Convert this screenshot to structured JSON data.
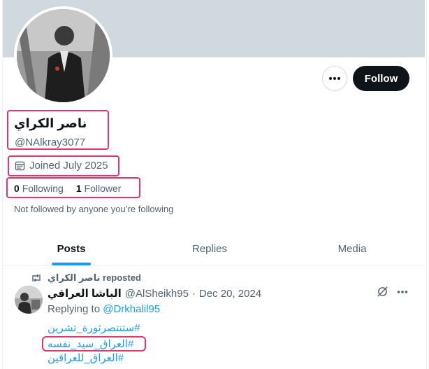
{
  "profile": {
    "display_name": "ناصر الكراي",
    "handle": "@NAlkray3077",
    "joined": "Joined July 2025",
    "following_count": "0",
    "following_label": "Following",
    "followers_count": "1",
    "followers_label": "Follower",
    "not_followed_text": "Not followed by anyone you’re following"
  },
  "actions": {
    "more_icon": "more-horizontal-icon",
    "follow_label": "Follow"
  },
  "tabs": [
    {
      "label": "Posts",
      "active": true
    },
    {
      "label": "Replies",
      "active": false
    },
    {
      "label": "Media",
      "active": false
    }
  ],
  "post": {
    "repost_name": "ناصر الكراي",
    "repost_suffix": "reposted",
    "author_name": "الباشا العراقي",
    "author_handle": "@AlSheikh95",
    "separator": "·",
    "date": "Dec 20, 2024",
    "replying_prefix": "Replying to",
    "replying_to": "@Drkhalil95",
    "hashtags": [
      "#ستنتصرثورة_تشرين",
      "#العراق_سيد_نفسه",
      "#العراق_للعراقين"
    ]
  },
  "colors": {
    "accent": "#1d9bf0",
    "highlight": "#e8336b",
    "banner": "#cfd9de",
    "follow_button": "#0f1419"
  }
}
